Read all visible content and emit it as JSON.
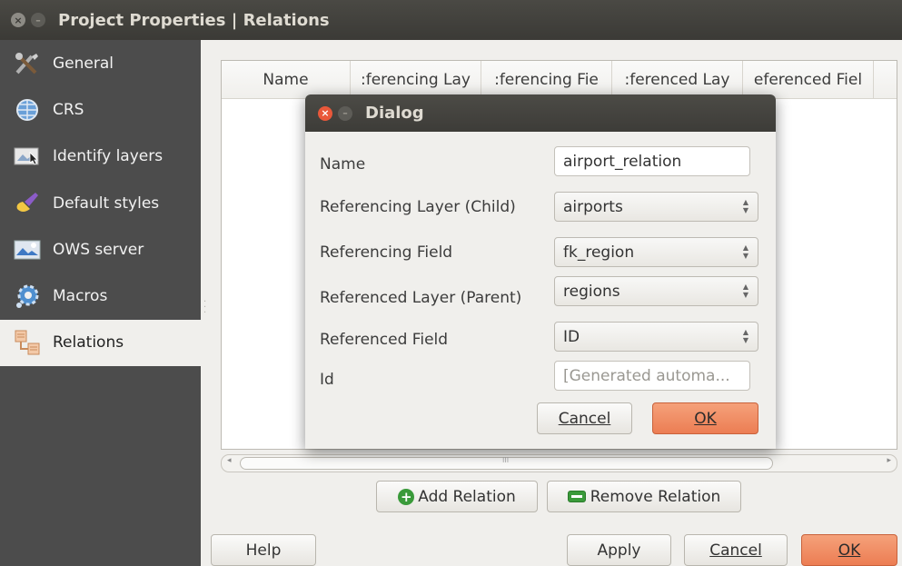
{
  "window": {
    "title": "Project Properties | Relations"
  },
  "sidebar": {
    "items": [
      {
        "label": "General",
        "icon": "tools-icon"
      },
      {
        "label": "CRS",
        "icon": "globe-icon"
      },
      {
        "label": "Identify layers",
        "icon": "identify-icon"
      },
      {
        "label": "Default styles",
        "icon": "brush-icon"
      },
      {
        "label": "OWS server",
        "icon": "ows-icon"
      },
      {
        "label": "Macros",
        "icon": "macro-gear-icon"
      },
      {
        "label": "Relations",
        "icon": "relations-icon",
        "active": true
      }
    ]
  },
  "table": {
    "columns": [
      "Name",
      "Referencing Layer",
      "Referencing Field",
      "Referenced Layer",
      "Referenced Field"
    ],
    "visible_headers": [
      "Name",
      ":ferencing Lay",
      ":ferencing Fie",
      ":ferenced Lay",
      "eferenced Fiel"
    ]
  },
  "scrollbar": {
    "grip": "III"
  },
  "buttons": {
    "add_relation": "Add Relation",
    "remove_relation": "Remove Relation",
    "help": "Help",
    "apply": "Apply",
    "cancel": "Cancel",
    "ok": "OK"
  },
  "dialog": {
    "title": "Dialog",
    "fields": {
      "name": {
        "label": "Name",
        "value": "airport_relation"
      },
      "referencing_layer": {
        "label": "Referencing Layer (Child)",
        "value": "airports"
      },
      "referencing_field": {
        "label": "Referencing Field",
        "value": "fk_region"
      },
      "referenced_layer": {
        "label": "Referenced Layer (Parent)",
        "value": "regions"
      },
      "referenced_field": {
        "label": "Referenced Field",
        "value": "ID"
      },
      "id": {
        "label": "Id",
        "placeholder": "[Generated automa..."
      }
    },
    "cancel": "Cancel",
    "ok": "OK"
  },
  "colors": {
    "accent": "#ec7d53",
    "sidebar_bg": "#4c4c4c",
    "titlebar_bg": "#3b3a36"
  }
}
